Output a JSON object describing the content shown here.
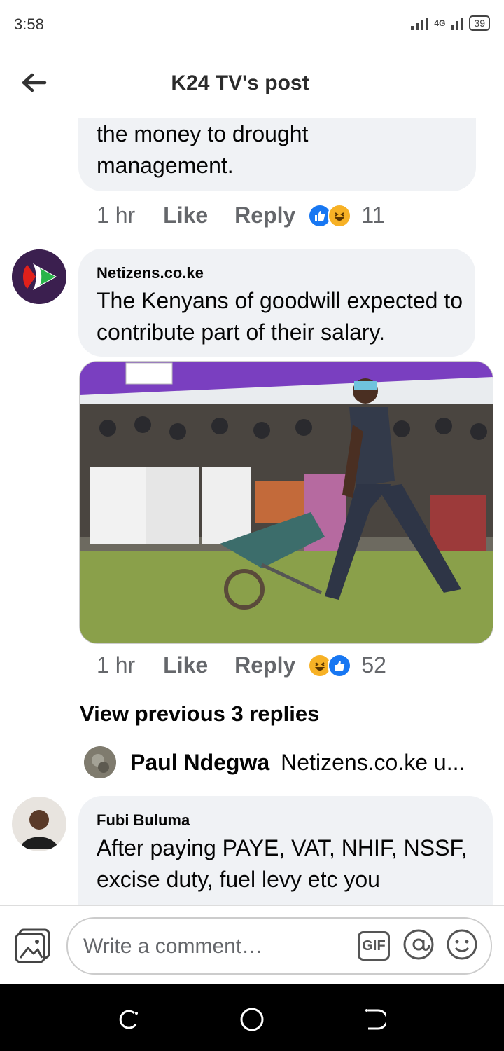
{
  "status": {
    "time": "3:58",
    "network": "4G",
    "battery": "39"
  },
  "header": {
    "title": "K24 TV's post"
  },
  "comments": [
    {
      "text": "the money to drought management.",
      "time": "1 hr",
      "like_label": "Like",
      "reply_label": "Reply",
      "reaction_count": "11"
    },
    {
      "author": "Netizens.co.ke",
      "text": "The Kenyans of goodwill expected to contribute part of their salary.",
      "time": "1 hr",
      "like_label": "Like",
      "reply_label": "Reply",
      "reaction_count": "52"
    },
    {
      "author": "Fubi Buluma",
      "text": "After paying PAYE, VAT, NHIF, NSSF, excise duty, fuel levy etc you"
    }
  ],
  "view_previous": "View previous 3 replies",
  "reply_preview": {
    "author": "Paul Ndegwa",
    "text": "Netizens.co.ke u..."
  },
  "composer": {
    "placeholder": "Write a comment…",
    "gif_label": "GIF"
  },
  "icons": [
    "back-arrow-icon",
    "like-reaction-icon",
    "haha-reaction-icon",
    "photo-icon",
    "gif-icon",
    "mention-icon",
    "emoji-icon",
    "recents-icon",
    "home-icon",
    "back-nav-icon"
  ]
}
